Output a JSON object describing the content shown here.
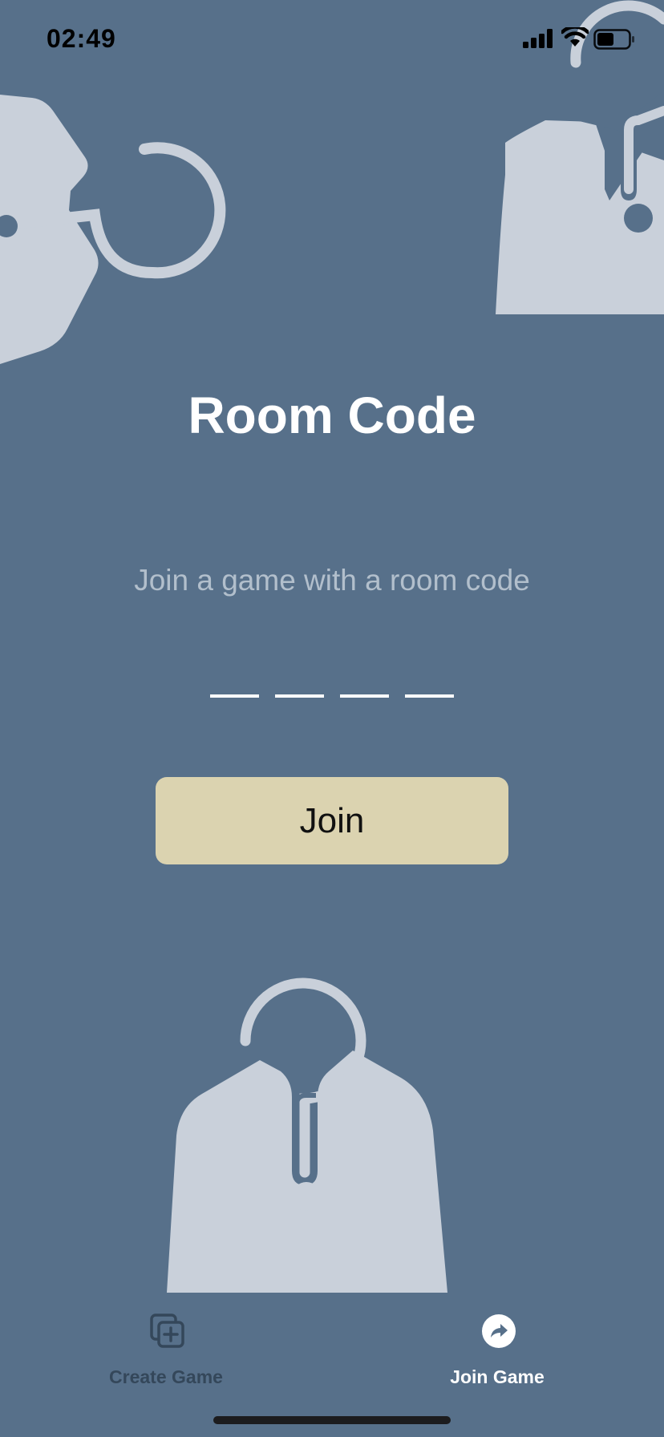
{
  "status_bar": {
    "time": "02:49",
    "signal_icon": "cellular-signal-icon",
    "wifi_icon": "wifi-icon",
    "battery_icon": "battery-icon"
  },
  "main": {
    "title": "Room Code",
    "subtitle": "Join a game with a room code",
    "code_input": {
      "slot_count": 4,
      "value": ""
    },
    "join_button_label": "Join"
  },
  "decorations": {
    "illustration_icon": "question-mark-hanger-icon"
  },
  "tab_bar": {
    "tabs": [
      {
        "label": "Create Game",
        "icon": "create-game-icon",
        "active": false
      },
      {
        "label": "Join Game",
        "icon": "join-game-icon",
        "active": true
      }
    ]
  },
  "colors": {
    "background": "#57708a",
    "illustration": "#c9d0da",
    "button": "#dbd3b0",
    "subtitle": "#b2bfcc",
    "inactive_tab": "#34475a",
    "active_tab": "#ffffff"
  }
}
